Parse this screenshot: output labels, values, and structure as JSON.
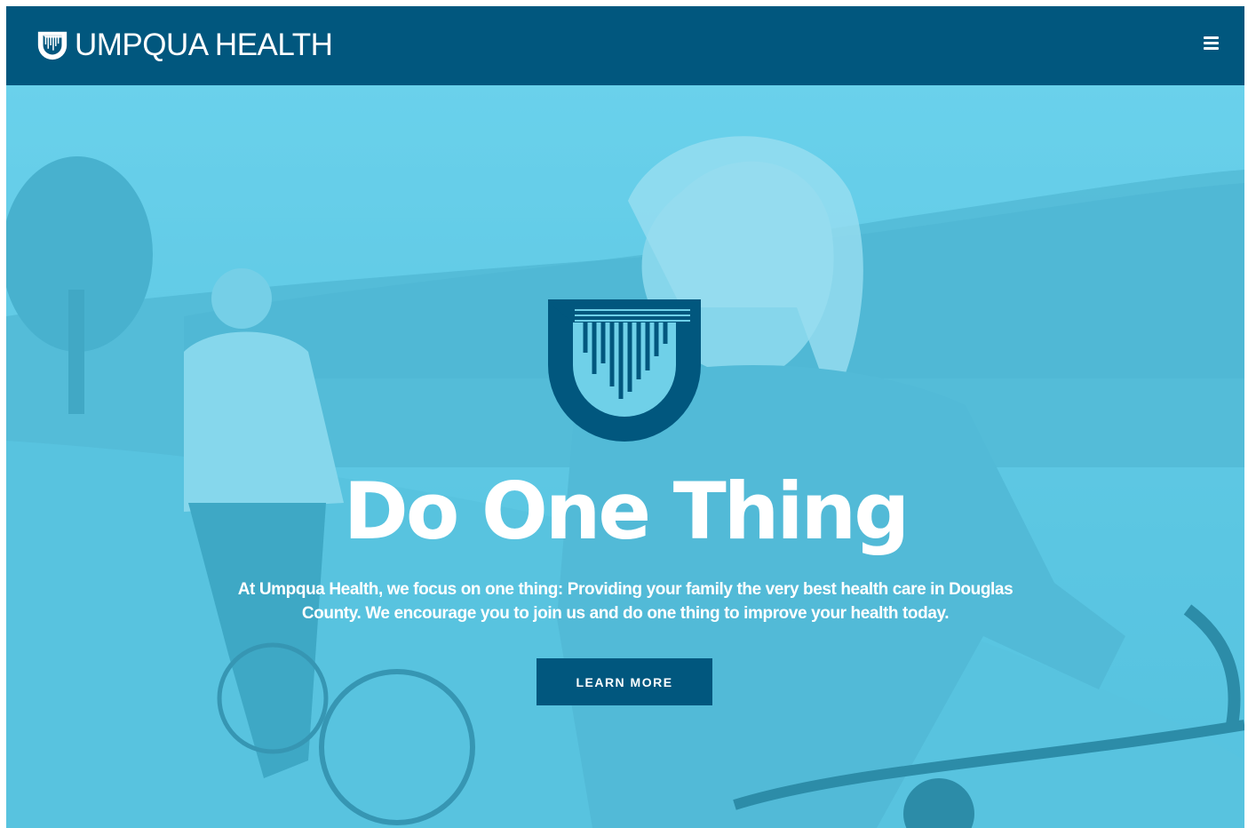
{
  "header": {
    "brand_name": "UMPQUA HEALTH",
    "logo_icon": "umpqua-shield-icon",
    "menu_icon": "hamburger-menu-icon"
  },
  "hero": {
    "title": "Do One Thing",
    "description": "At Umpqua Health, we focus on one thing: Providing your family the very best health care in Douglas County. We encourage you to join us and do one thing to improve your health today.",
    "cta_label": "LEARN MORE",
    "logo_icon": "umpqua-shield-icon",
    "background_image": "couple-cycling-photo"
  },
  "colors": {
    "brand_navy": "#01577e",
    "hero_tint": "#6fd0e8",
    "text_white": "#ffffff"
  }
}
